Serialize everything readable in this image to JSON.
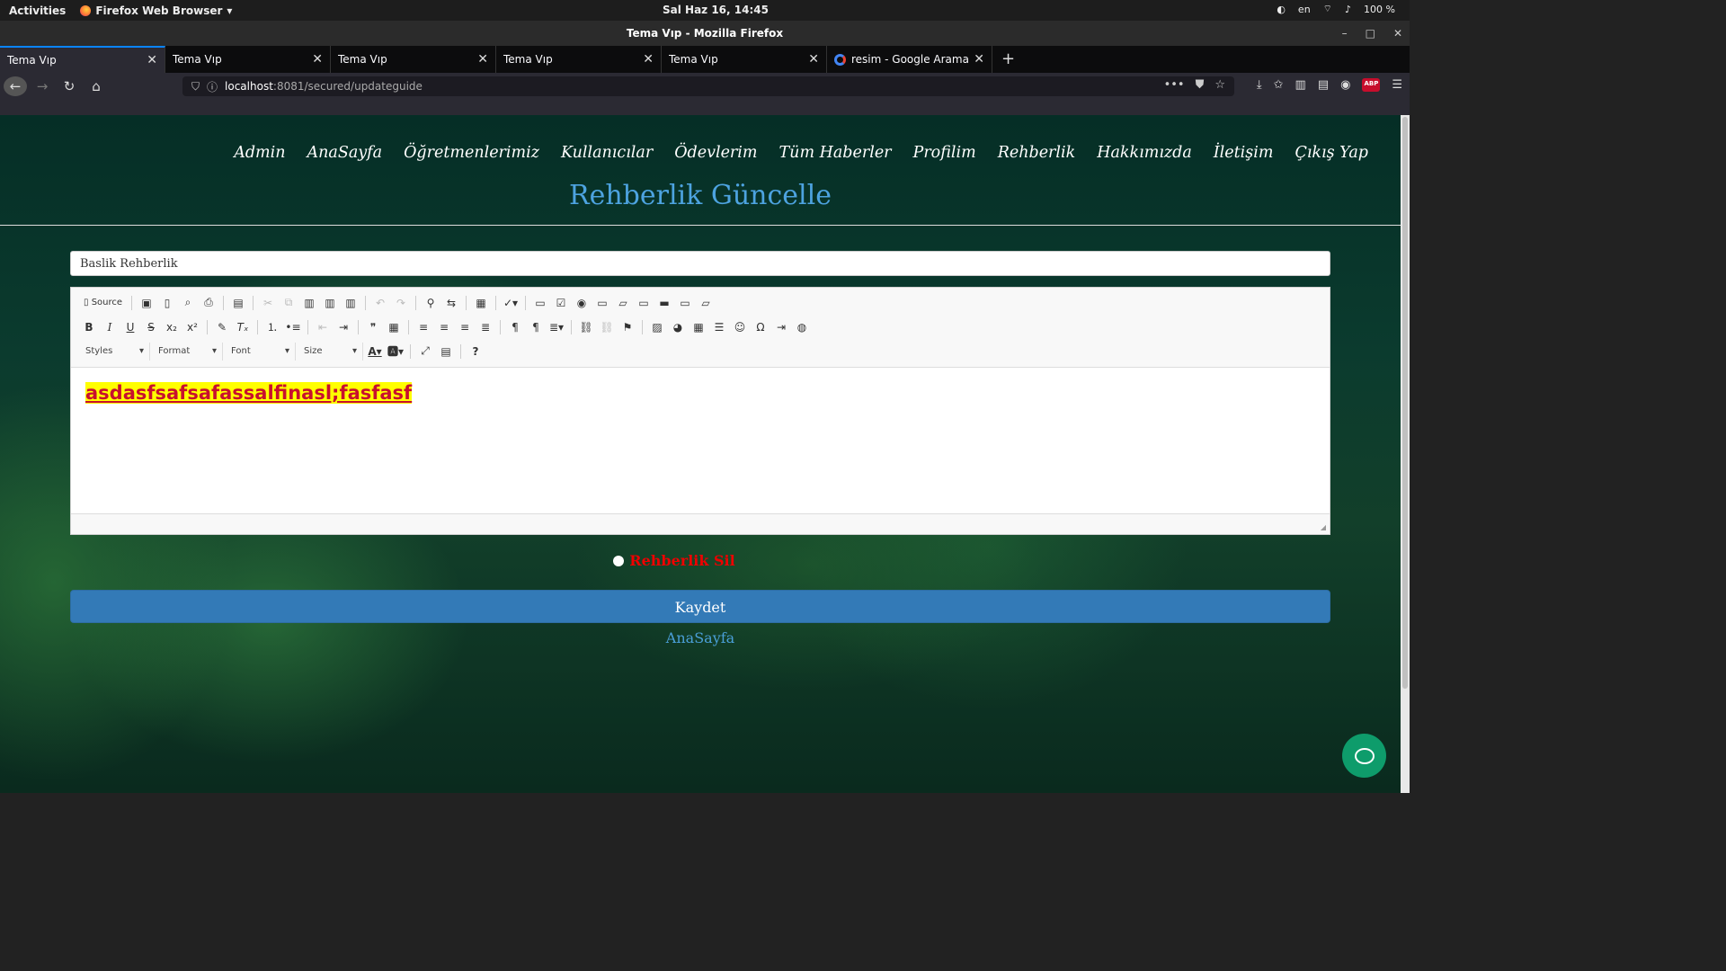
{
  "system_bar": {
    "activities": "Activities",
    "app_name": "Firefox Web Browser",
    "clock": "Sal Haz 16, 14:45",
    "language": "en",
    "battery": "100 %"
  },
  "window": {
    "title": "Tema Vıp - Mozilla Firefox"
  },
  "tabs": [
    {
      "label": "Tema Vıp"
    },
    {
      "label": "Tema Vıp"
    },
    {
      "label": "Tema Vıp"
    },
    {
      "label": "Tema Vıp"
    },
    {
      "label": "Tema Vıp"
    },
    {
      "label": "resim - Google Arama"
    }
  ],
  "url": {
    "host": "localhost",
    "path": ":8081/secured/updateguide"
  },
  "nav_menu": [
    "Admin",
    "AnaSayfa",
    "Öğretmenlerimiz",
    "Kullanıcılar",
    "Ödevlerim",
    "Tüm Haberler",
    "Profilim",
    "Rehberlik",
    "Hakkımızda",
    "İletişim",
    "Çıkış Yap"
  ],
  "page_title": "Rehberlik Güncelle",
  "form": {
    "title_value": "Baslik Rehberlik",
    "editor": {
      "source_label": "Source",
      "styles_label": "Styles",
      "format_label": "Format",
      "font_label": "Font",
      "size_label": "Size",
      "content": "asdasfsafsafassalfinasl;fasfasf"
    },
    "delete_label": "Rehberlik Sil",
    "save_label": "Kaydet",
    "home_link": "AnaSayfa"
  },
  "colors": {
    "accent": "#337ab7",
    "title_blue": "#4da3e0",
    "delete_red": "#ee0000",
    "highlight": "#ffff00",
    "chat": "#0e9c6b"
  }
}
